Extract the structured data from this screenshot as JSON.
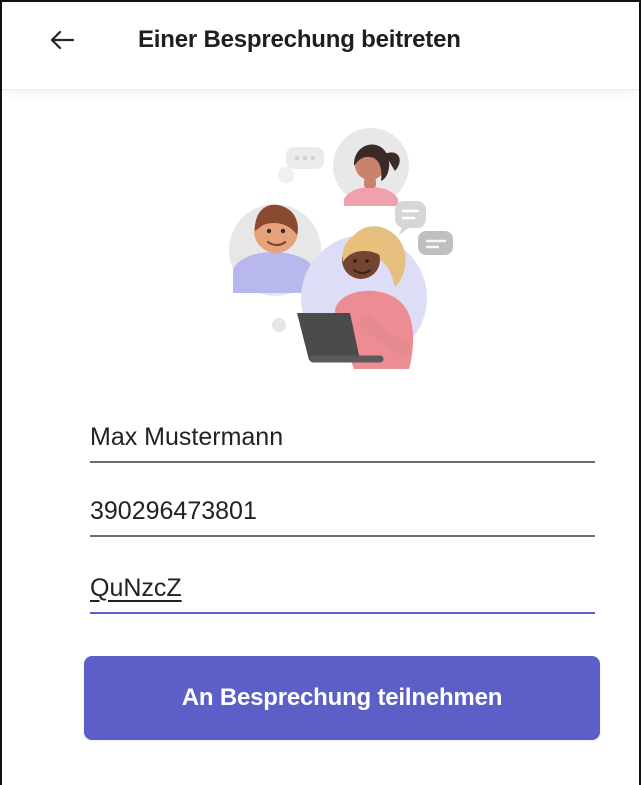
{
  "header": {
    "back_icon": "arrow-left-icon",
    "title": "Einer Besprechung beitreten"
  },
  "illustration": {
    "icon": "meeting-people-illustration"
  },
  "form": {
    "name_value": "Max Mustermann",
    "meeting_id_value": "390296473801",
    "passcode_value": "QuNzcZ"
  },
  "actions": {
    "join_label": "An Besprechung teilnehmen"
  },
  "colors": {
    "accent": "#5b5fc7",
    "text": "#242424",
    "inactive_underline": "#6d6d6d"
  }
}
